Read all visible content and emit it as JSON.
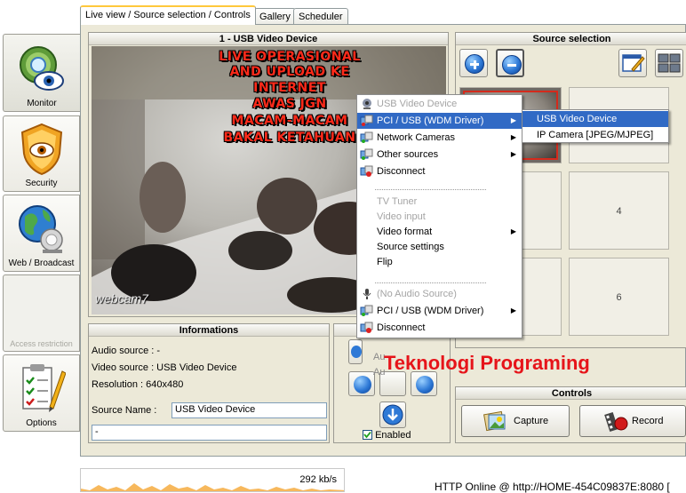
{
  "sidebar": {
    "items": [
      {
        "label": "Monitor",
        "icon": "monitor-eye-icon",
        "state": "selected"
      },
      {
        "label": "Security",
        "icon": "security-shield-icon",
        "state": "normal"
      },
      {
        "label": "Web / Broadcast",
        "icon": "web-globe-icon",
        "state": "normal"
      },
      {
        "label": "Access restriction",
        "icon": "",
        "state": "disabled"
      },
      {
        "label": "Options",
        "icon": "options-checklist-icon",
        "state": "normal"
      }
    ]
  },
  "tabs": [
    {
      "label": "Live view / Source selection / Controls",
      "active": true
    },
    {
      "label": "Gallery",
      "active": false
    },
    {
      "label": "Scheduler",
      "active": false
    }
  ],
  "video": {
    "title": "1 - USB Video Device",
    "overlay_lines": [
      "LIVE OPERASIONAL",
      "AND UPLOAD KE",
      "INTERNET",
      "AWAS JGN",
      "MACAM-MACAM",
      "BAKAL KETAHUAN"
    ],
    "logo": "webcam7"
  },
  "info": {
    "title": "Informations",
    "audio_source": "Audio source : -",
    "video_source": "Video source : USB Video Device",
    "resolution": "Resolution : 640x480",
    "source_name_label": "Source Name :",
    "source_name_value": "USB Video Device",
    "extra_value": "-"
  },
  "source_selection": {
    "title": "Source selection",
    "cells": [
      "",
      "",
      "",
      "4",
      "",
      "6"
    ]
  },
  "ptz": {
    "title_fragment": "E",
    "enabled_label": "Enabled",
    "enabled_checked": true,
    "au_labels": [
      "Au",
      "Au"
    ]
  },
  "controls": {
    "title": "Controls",
    "capture_label": "Capture",
    "record_label": "Record"
  },
  "context_menu": {
    "items": [
      {
        "label": "USB Video Device",
        "disabled": true,
        "icon": "webcam-icon",
        "submenu": false
      },
      {
        "label": "PCI / USB (WDM Driver)",
        "disabled": false,
        "icon": "plugin-icon",
        "submenu": true,
        "highlighted": true
      },
      {
        "label": "Network Cameras",
        "disabled": false,
        "icon": "plugin-icon",
        "submenu": true
      },
      {
        "label": "Other sources",
        "disabled": false,
        "icon": "plugin-icon",
        "submenu": true
      },
      {
        "label": "Disconnect",
        "disabled": false,
        "icon": "disconnect-icon",
        "submenu": false
      },
      {
        "label": "TV Tuner",
        "disabled": true,
        "icon": "",
        "submenu": false
      },
      {
        "label": "Video input",
        "disabled": true,
        "icon": "",
        "submenu": false
      },
      {
        "label": "Video format",
        "disabled": false,
        "icon": "",
        "submenu": true
      },
      {
        "label": "Source settings",
        "disabled": false,
        "icon": "",
        "submenu": false
      },
      {
        "label": "Flip",
        "disabled": false,
        "icon": "",
        "submenu": false
      },
      {
        "label": "(No Audio Source)",
        "disabled": true,
        "icon": "microphone-icon",
        "submenu": false
      },
      {
        "label": "PCI / USB (WDM Driver)",
        "disabled": false,
        "icon": "plugin-icon",
        "submenu": true
      },
      {
        "label": "Disconnect",
        "disabled": false,
        "icon": "disconnect-icon",
        "submenu": false
      }
    ],
    "submenu": [
      {
        "label": "USB Video Device",
        "highlighted": true
      },
      {
        "label": "IP Camera [JPEG/MJPEG]",
        "highlighted": false
      }
    ]
  },
  "watermark": "Teknologi Programing",
  "status": {
    "bandwidth": "292 kb/s",
    "server": "HTTP Online @ http://HOME-454C09837E:8080 ["
  },
  "colors": {
    "menu_highlight": "#316ac5",
    "overlay_text": "#ff2a1a",
    "watermark": "#e6141a",
    "panel_bg": "#ece9d8"
  }
}
